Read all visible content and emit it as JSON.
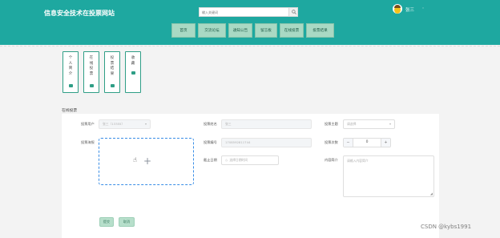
{
  "header": {
    "site_title": "信息安全技术在投票网站",
    "search_placeholder": "输入关键词",
    "user_name": "张三",
    "user_caret": "˅"
  },
  "nav": [
    {
      "label": "首页",
      "key": "home"
    },
    {
      "label": "交流论坛",
      "key": "forum"
    },
    {
      "label": "通知公告",
      "key": "notice"
    },
    {
      "label": "留言板",
      "key": "messages"
    },
    {
      "label": "在线投票",
      "key": "vote"
    },
    {
      "label": "投票结果",
      "key": "results"
    }
  ],
  "side_cards": [
    {
      "label": "个人简介",
      "key": "profile"
    },
    {
      "label": "在线投票",
      "key": "online-vote"
    },
    {
      "label": "投票结果",
      "key": "vote-results"
    },
    {
      "label": "收藏",
      "key": "favorites"
    }
  ],
  "section_title": "在线投票",
  "form": {
    "voter_label": "投票用户",
    "voter_value": "张三（13355）",
    "vote_name_label": "投票姓名",
    "vote_name_value": "张三",
    "vote_topic_label": "投票主题",
    "vote_topic_placeholder": "请选择",
    "vote_image_label": "投票海报",
    "vote_number_label": "投票编号",
    "vote_number_value": "1708592811744",
    "vote_count_label": "投票次数",
    "vote_count_value": "0",
    "deadline_label": "截止日期",
    "deadline_placeholder": "选择日期时间",
    "content_label": "内容简介",
    "content_placeholder": "请输入内容简介",
    "submit_label": "提交",
    "cancel_label": "取消"
  },
  "watermark": "CSDN @kybs1991",
  "colors": {
    "header_bg": "#1ea8a0",
    "nav_bg": "#a9d9c4",
    "accent": "#2f9e86",
    "upload_border": "#3a8ee6"
  }
}
